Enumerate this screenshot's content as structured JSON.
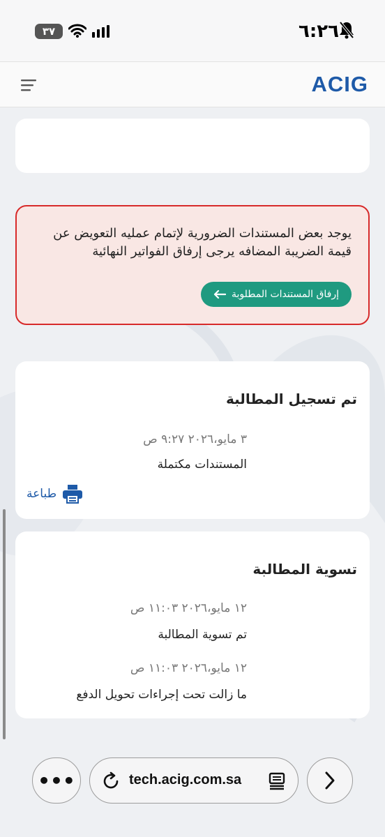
{
  "status_bar": {
    "time": "٦:٢٦",
    "battery": "٣٧"
  },
  "header": {
    "logo": "ACIG"
  },
  "alert": {
    "message": "يوجد بعض المستندات الضرورية لإتمام عمليه التعويض عن قيمة الضريبة المضافه يرجى إرفاق الفواتير النهائية",
    "button_label": "إرفاق المستندات المطلوبة",
    "border_color": "#d72a2a",
    "button_color": "#1f9a80"
  },
  "registered_card": {
    "title": "تم تسجيل المطالبة",
    "timestamp": "٣ مايو،٢٠٢٦ ٩:٢٧ ص",
    "description": "المستندات مكتملة",
    "print_label": "طباعة"
  },
  "settlement_card": {
    "title": "تسوية المطالبة",
    "entries": [
      {
        "timestamp": "١٢ مايو،٢٠٢٦ ١١:٠٣ ص",
        "description": "تم تسوية المطالبة"
      },
      {
        "timestamp": "١٢ مايو،٢٠٢٦ ١١:٠٣ ص",
        "description": "ما زالت تحت إجراءات تحويل الدفع"
      }
    ]
  },
  "browser": {
    "url": "tech.acig.com.sa",
    "more_label": "•••"
  },
  "colors": {
    "brand_blue": "#1e5aa8",
    "accent_green": "#1f9a80"
  }
}
